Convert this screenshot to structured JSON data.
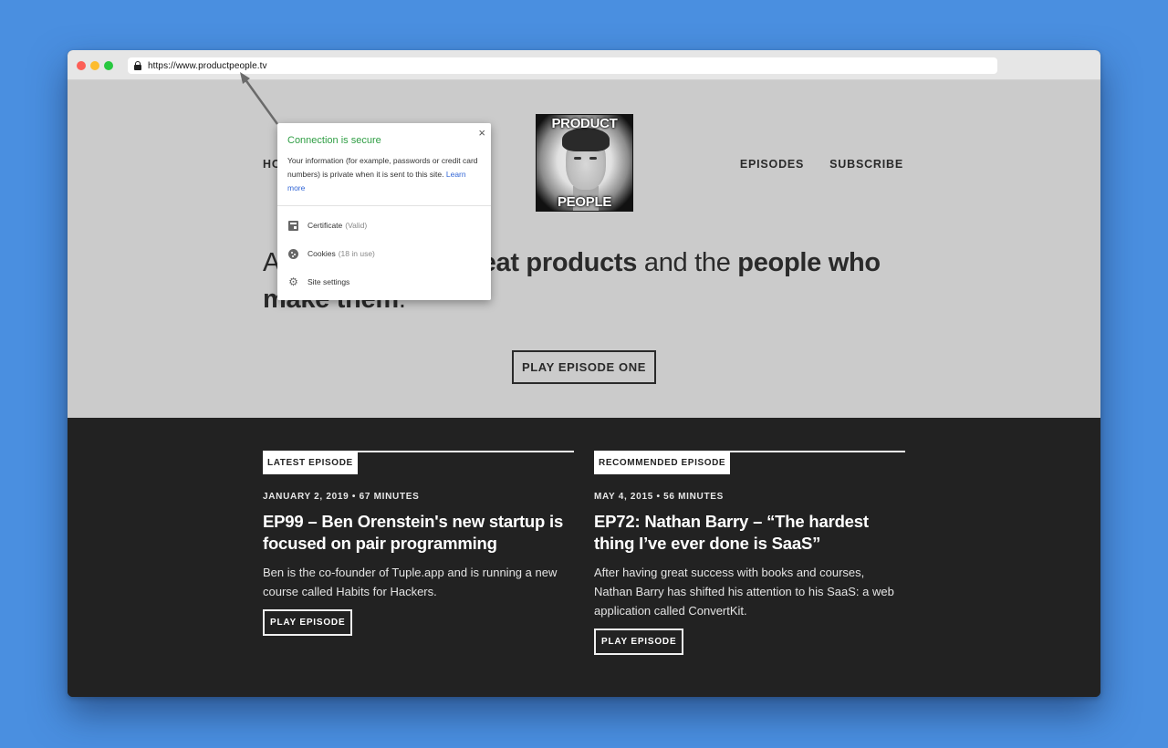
{
  "browser": {
    "url": "https://www.productpeople.tv"
  },
  "nav": {
    "home": "HOME",
    "episodes": "EPISODES",
    "subscribe": "SUBSCRIBE"
  },
  "logo": {
    "top_text": "PRODUCT",
    "bottom_text": "PEOPLE"
  },
  "hero": {
    "text_1": "A podcast about ",
    "bold_1": "great products",
    "text_2": " and the ",
    "bold_2": "people who make them",
    "text_3": ".",
    "play_button": "PLAY EPISODE ONE"
  },
  "episodes": [
    {
      "tag": "LATEST EPISODE",
      "meta": "JANUARY 2, 2019 • 67 MINUTES",
      "title": "EP99 – Ben Orenstein's new startup is focused on pair programming",
      "description": "Ben is the co-founder of Tuple.app and is running a new course called Habits for Hackers.",
      "play_button": "PLAY EPISODE"
    },
    {
      "tag": "RECOMMENDED EPISODE",
      "meta": "MAY 4, 2015 • 56 MINUTES",
      "title": "EP72: Nathan Barry – “The hardest thing I’ve ever done is SaaS”",
      "description": "After having great success with books and courses, Nathan Barry has shifted his attention to his SaaS: a web application called ConvertKit.",
      "play_button": "PLAY EPISODE"
    }
  ],
  "security_popup": {
    "title": "Connection is secure",
    "body": "Your information (for example, passwords or credit card numbers) is private when it is sent to this site.",
    "learn_more": "Learn more",
    "close": "×",
    "items": [
      {
        "icon": "certificate-icon",
        "label": "Certificate",
        "sub": "(Valid)"
      },
      {
        "icon": "cookie-icon",
        "label": "Cookies",
        "sub": "(18 in use)"
      },
      {
        "icon": "gear-icon",
        "label": "Site settings",
        "sub": ""
      }
    ]
  },
  "colors": {
    "desktop": "#4a8fe0",
    "hero_bg": "#cbcbcb",
    "dark_bg": "#222222",
    "secure_green": "#2f9e44",
    "link_blue": "#3367d6"
  }
}
